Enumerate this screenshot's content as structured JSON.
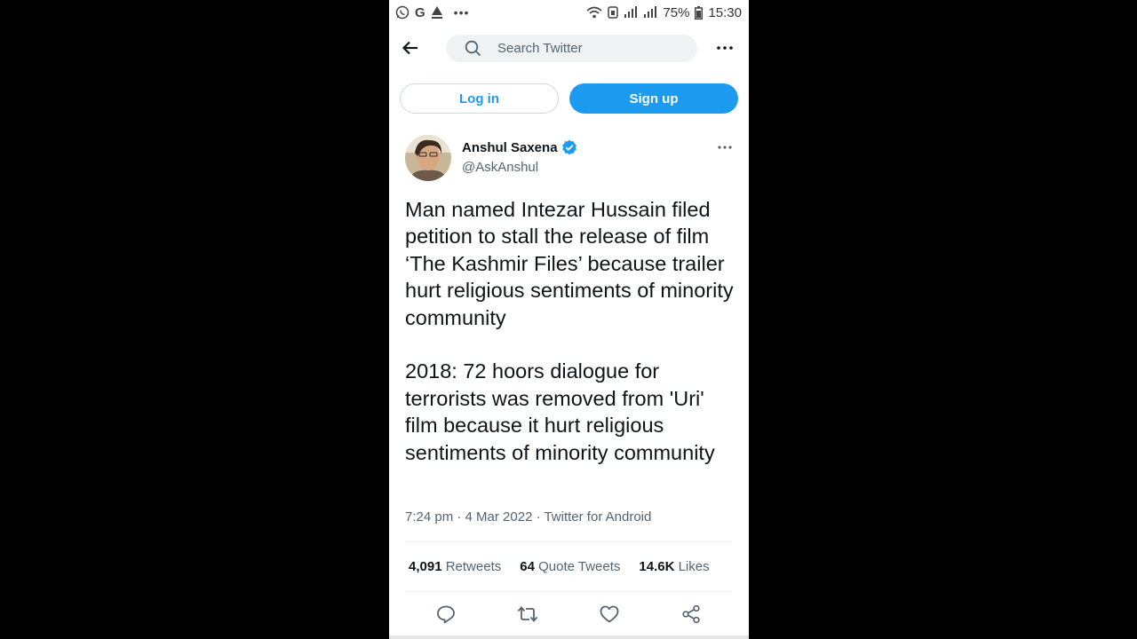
{
  "status_bar": {
    "left_icons": [
      "whatsapp-icon",
      "google-icon",
      "notification-icon"
    ],
    "google_letter": "G",
    "battery": "75%",
    "time": "15:30"
  },
  "nav": {
    "search_placeholder": "Search Twitter"
  },
  "auth": {
    "login_label": "Log in",
    "signup_label": "Sign up"
  },
  "tweet": {
    "author_name": "Anshul Saxena",
    "author_handle": "@AskAnshul",
    "paragraph_1": "Man named Intezar Hussain filed petition to stall the release of film ‘The Kashmir Files’ because trailer hurt religious sentiments of minority community",
    "paragraph_2": "2018: 72 hoors dialogue for terrorists was removed from 'Uri' film because it hurt religious sentiments of minority community",
    "timestamp": "7:24 pm · 4 Mar 2022 · Twitter for Android",
    "retweets_count": "4,091",
    "retweets_label": "Retweets",
    "quotes_count": "64",
    "quotes_label": "Quote Tweets",
    "likes_count": "14.6K",
    "likes_label": "Likes"
  },
  "colors": {
    "accent": "#1d9bf0",
    "text_primary": "#0f1419",
    "text_secondary": "#536471"
  }
}
